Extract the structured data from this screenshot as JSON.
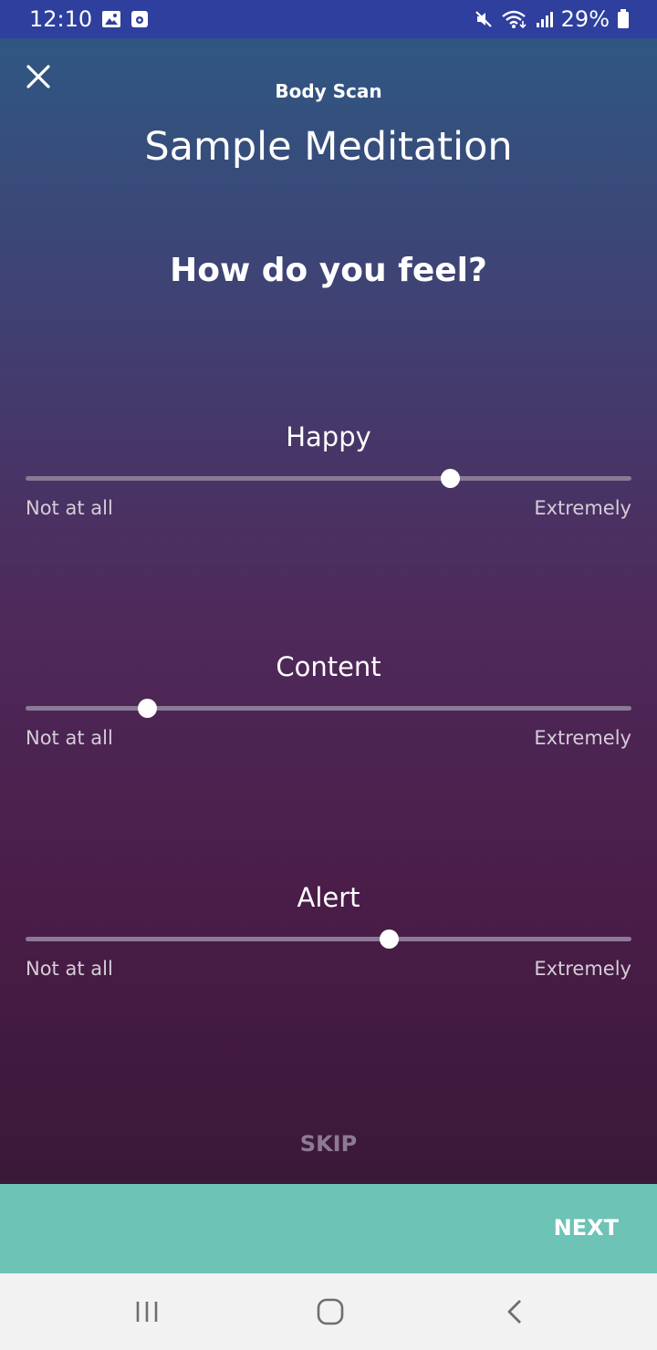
{
  "status_bar": {
    "time": "12:10",
    "battery": "29%",
    "icons": [
      "image-icon",
      "media-icon",
      "mute-icon",
      "wifi-icon",
      "signal-icon",
      "battery-icon"
    ]
  },
  "header": {
    "subtitle": "Body Scan",
    "title": "Sample Meditation",
    "close_icon": "close-icon"
  },
  "question": "How do you feel?",
  "sliders": [
    {
      "label": "Happy",
      "min_label": "Not at all",
      "max_label": "Extremely",
      "value": 0.7
    },
    {
      "label": "Content",
      "min_label": "Not at all",
      "max_label": "Extremely",
      "value": 0.2
    },
    {
      "label": "Alert",
      "min_label": "Not at all",
      "max_label": "Extremely",
      "value": 0.6
    }
  ],
  "skip_label": "SKIP",
  "next_label": "NEXT",
  "colors": {
    "status_bar": "#2f3f9e",
    "next_bar": "#6cc3b6",
    "gradient_top": "#2f5782",
    "gradient_bottom": "#3a1838"
  },
  "nav_bar": {
    "icons": [
      "recent-apps-icon",
      "home-icon",
      "back-icon"
    ]
  }
}
